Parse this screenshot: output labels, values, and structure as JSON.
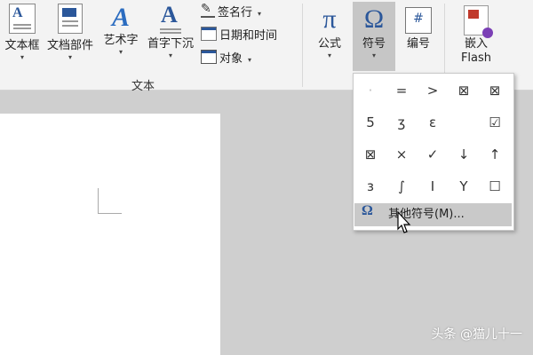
{
  "ribbon": {
    "textbox": "文本框",
    "docparts": "文档部件",
    "wordart": "艺术字",
    "dropcap": "首字下沉",
    "signature": "签名行",
    "datetime": "日期和时间",
    "object": "对象",
    "group_label": "文本",
    "equation": "公式",
    "symbol": "符号",
    "number": "编号",
    "embed_flash_line1": "嵌入",
    "embed_flash_line2": "Flash",
    "pi_glyph": "π",
    "omega_glyph": "Ω",
    "dropdown_arrow": "▾"
  },
  "symbols": [
    {
      "glyph": "·"
    },
    {
      "glyph": "="
    },
    {
      "glyph": ">"
    },
    {
      "glyph": "⊠"
    },
    {
      "glyph": "⊠"
    },
    {
      "glyph": "5̄"
    },
    {
      "glyph": "ʒ"
    },
    {
      "glyph": "ε"
    },
    {
      "glyph": ""
    },
    {
      "glyph": "☑"
    },
    {
      "glyph": "⊠"
    },
    {
      "glyph": "×"
    },
    {
      "glyph": "✓"
    },
    {
      "glyph": "↓"
    },
    {
      "glyph": "↑"
    },
    {
      "glyph": "ɜ"
    },
    {
      "glyph": "∫"
    },
    {
      "glyph": "I"
    },
    {
      "glyph": "Y"
    },
    {
      "glyph": "☐"
    }
  ],
  "more_symbols": {
    "icon": "Ω",
    "label": "其他符号(M)..."
  },
  "watermark": "头条 @猫儿十一"
}
